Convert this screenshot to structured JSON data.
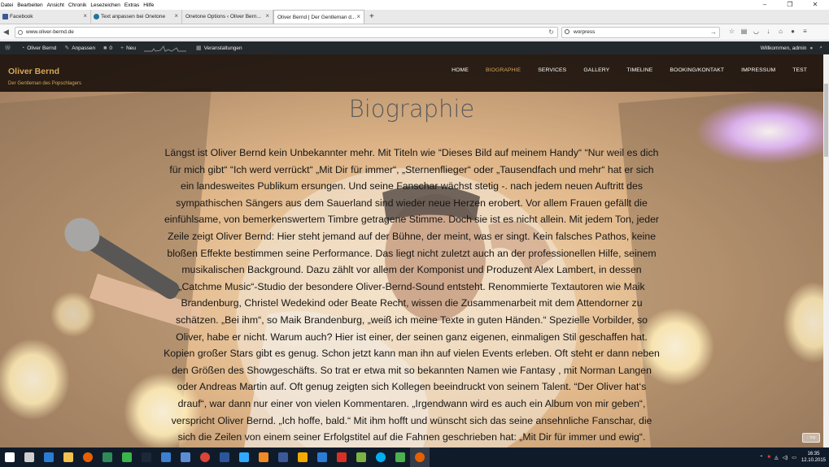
{
  "menu": [
    "Datei",
    "Bearbeiten",
    "Ansicht",
    "Chronik",
    "Lesezeichen",
    "Extras",
    "Hilfe"
  ],
  "window_controls": {
    "minimize": "–",
    "maximize": "❐",
    "close": "✕"
  },
  "tabs": [
    {
      "label": "Facebook",
      "color": "#3b5998"
    },
    {
      "label": "Text anpassen bei Onetone",
      "color": "#21759b"
    },
    {
      "label": "Onetone Options ‹ Oliver Bern...",
      "color": "#888888"
    },
    {
      "label": "Oliver Bernd | Der Gentleman d...",
      "color": "#888888"
    }
  ],
  "new_tab": "+",
  "nav": {
    "back": "◀",
    "url": "www.oliver-bernd.de",
    "search_value": "worpress"
  },
  "toolbar_icons": [
    "star-icon",
    "bookmarks-icon",
    "pocket-icon",
    "download-icon",
    "home-icon",
    "chat-icon",
    "menu-icon"
  ],
  "adminbar": {
    "site_name": "Oliver Bernd",
    "customize": "Anpassen",
    "comments": "0",
    "new": "Neu",
    "events": "Veranstaltungen",
    "greeting": "Willkommen, admin"
  },
  "site": {
    "logo": "Oliver Bernd",
    "tagline": "Der Gentleman des Popschlagers",
    "nav": [
      "HOME",
      "BIOGRAPHIE",
      "SERVICES",
      "GALLERY",
      "TIMELINE",
      "BOOKING/KONTAKT",
      "IMPRESSUM",
      "TEST"
    ],
    "active_nav": "BIOGRAPHIE",
    "accent": "#d8a657"
  },
  "content": {
    "title": "Biographie",
    "body": "Längst ist Oliver Bernd kein Unbekannter mehr. Mit Titeln wie “Dieses Bild auf meinem Handy“ “Nur weil es dich für mich gibt“ “Ich werd verrückt“ „Mit Dir für immer“, „Sternenflieger“ oder „Tausendfach und mehr“ hat er sich ein landesweites Publikum ersungen. Und seine Fanschar wächst stetig -. nach jedem neuen Auftritt des sympathischen Sängers aus dem Sauerland sind wieder neue Herzen erobert. Vor allem Frauen gefällt die einfühlsame, von bemerkenswertem Timbre getragene Stimme. Doch sie ist es nicht allein. Mit jedem Ton, jeder Zeile zeigt Oliver Bernd: Hier steht jemand auf der Bühne, der meint, was er singt. Kein falsches Pathos, keine bloßen Effekte bestimmen seine Performance. Das liegt nicht zuletzt auch an der professionellen Hilfe, seinem musikalischen Background. Dazu zählt vor allem der Komponist und Produzent Alex Lambert, in dessen „Catchme Music“-Studio der besondere Oliver-Bernd-Sound entsteht. Renommierte Textautoren wie Maik Brandenburg, Christel Wedekind oder Beate Recht, wissen die Zusammenarbeit mit dem Attendorner zu schätzen. „Bei ihm“, so Maik Brandenburg, „weiß ich meine Texte in guten Händen.“ Spezielle Vorbilder, so Oliver, habe er nicht. Warum auch? Hier ist einer, der seinen ganz eigenen, einmaligen Stil geschaffen hat. Kopien großer Stars gibt es genug. Schon jetzt kann man ihn auf vielen Events erleben. Oft steht er dann neben den Größen des Showgeschäfts. So trat er etwa mit so bekannten Namen wie Fantasy , mit Norman Langen oder Andreas Martin auf. Oft genug zeigten sich Kollegen beeindruckt von seinem Talent. “Der Oliver hat‘s drauf“, war dann nur einer von vielen Kommentaren. „Irgendwann wird es auch ein Album von mir geben“, verspricht Oliver Bernd. „Ich hoffe, bald.“ Mit ihm hofft und wünscht sich das seine ansehnliche Fanschar, die sich die Zeilen von einem seiner Erfolgstitel auf die Fahnen geschrieben hat: „Mit Dir für immer und ewig“.",
    "scroll_top": "↑ top"
  },
  "taskbar": {
    "apps": [
      {
        "icon": "windows-start-icon",
        "color": "#ffffff"
      },
      {
        "icon": "task-view-icon",
        "color": "#cfcfcf"
      },
      {
        "icon": "edge-icon",
        "color": "#2b7cd3"
      },
      {
        "icon": "explorer-icon",
        "color": "#f2c14e"
      },
      {
        "icon": "firefox-icon",
        "color": "#e66000"
      },
      {
        "icon": "app-green-icon",
        "color": "#2e8b57"
      },
      {
        "icon": "refresh-icon",
        "color": "#39b54a"
      },
      {
        "icon": "steam-icon",
        "color": "#1b2838"
      },
      {
        "icon": "app-blue-icon",
        "color": "#3d7fd1"
      },
      {
        "icon": "app-gear-icon",
        "color": "#5b8dd6"
      },
      {
        "icon": "chrome-icon",
        "color": "#db4437"
      },
      {
        "icon": "word-icon",
        "color": "#2b579a"
      },
      {
        "icon": "photoshop-icon",
        "color": "#31a8ff"
      },
      {
        "icon": "vlc-icon",
        "color": "#f08a24"
      },
      {
        "icon": "app-w-icon",
        "color": "#3b5998"
      },
      {
        "icon": "app-orange-icon",
        "color": "#f2a900"
      },
      {
        "icon": "app-shield-icon",
        "color": "#2b7cd3"
      },
      {
        "icon": "app-red-icon",
        "color": "#d93025"
      },
      {
        "icon": "app-image-icon",
        "color": "#7cb342"
      },
      {
        "icon": "skype-icon",
        "color": "#00aff0"
      },
      {
        "icon": "app-square-icon",
        "color": "#4caf50"
      },
      {
        "icon": "firefox-active-icon",
        "color": "#e66000"
      }
    ],
    "time": "16:35",
    "date": "12.10.2015"
  }
}
